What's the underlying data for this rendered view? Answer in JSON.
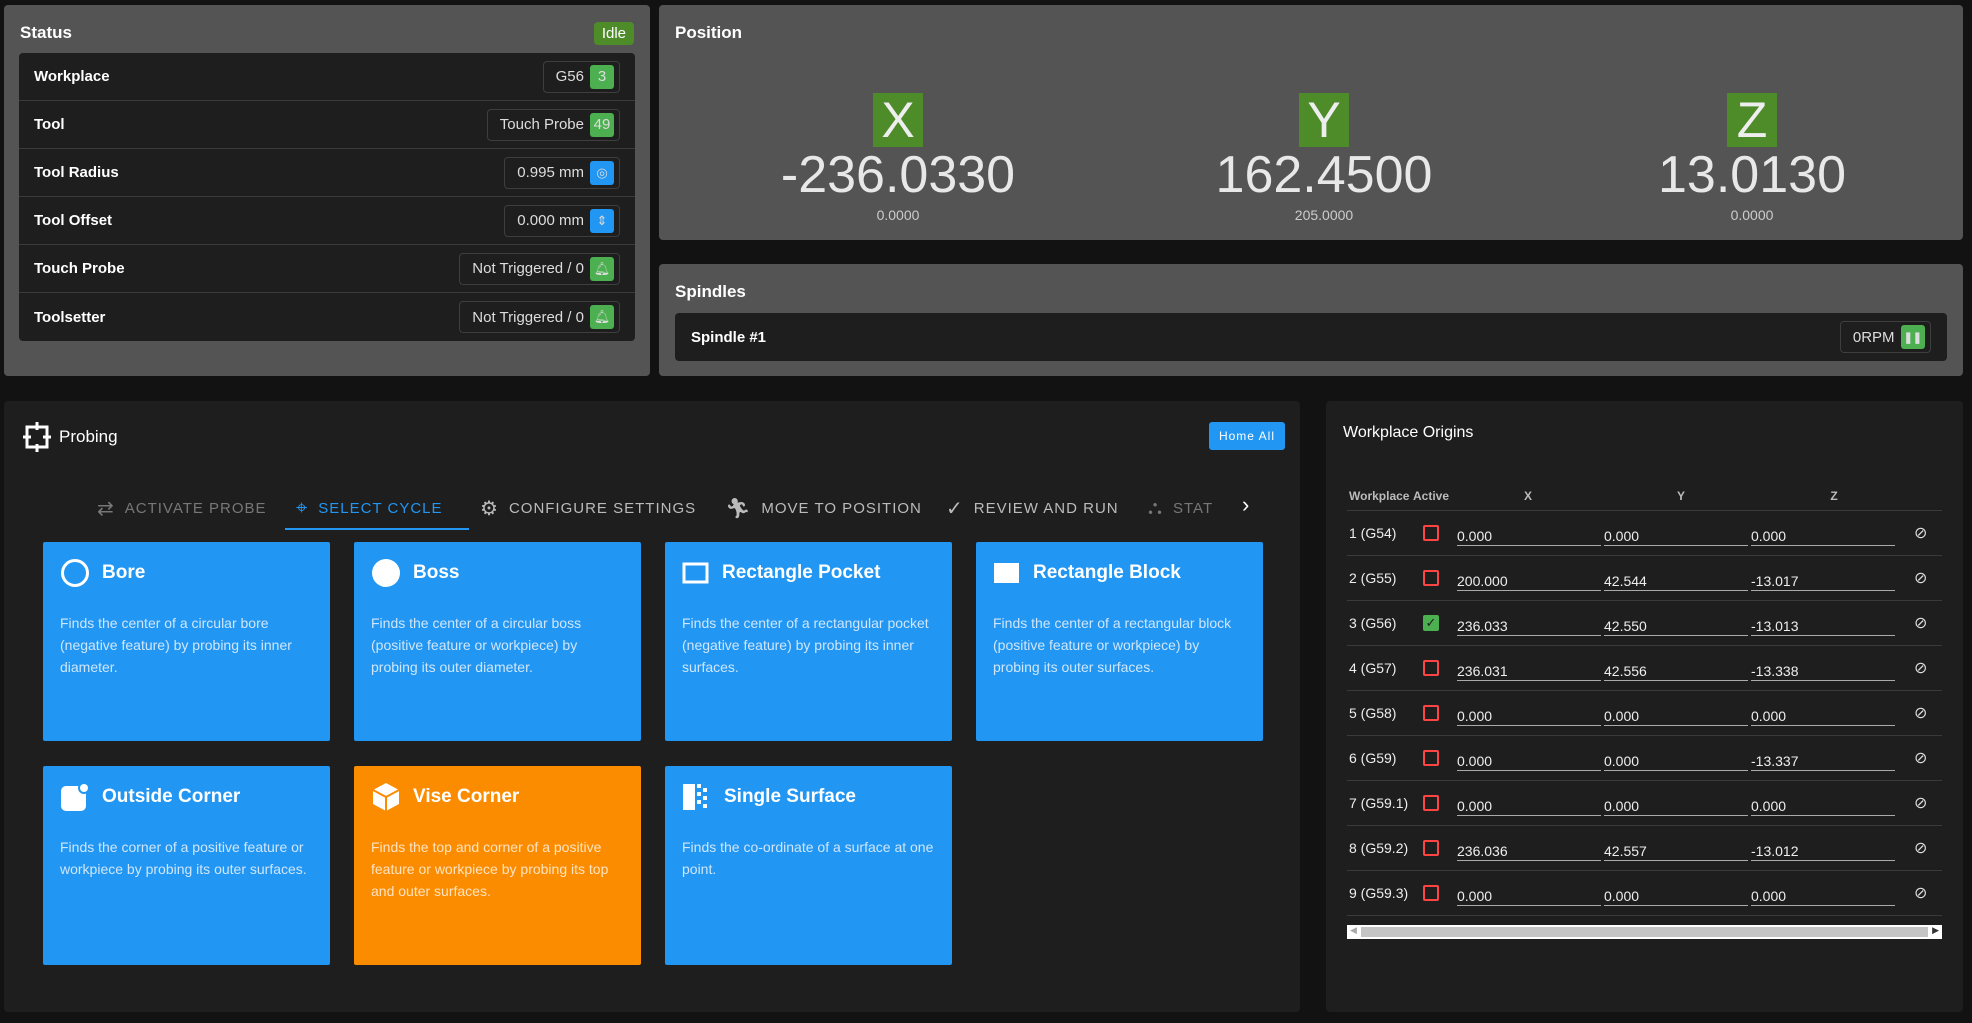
{
  "status": {
    "title": "Status",
    "state": "Idle",
    "rows": [
      {
        "label": "Workplace",
        "value": "G56",
        "chip": "3",
        "chip_color": "#4caf50",
        "icon": ""
      },
      {
        "label": "Tool",
        "value": "Touch Probe",
        "chip": "49",
        "chip_color": "#4caf50",
        "icon": ""
      },
      {
        "label": "Tool Radius",
        "value": "0.995 mm",
        "chip": "",
        "chip_color": "#2196f3",
        "icon": "radius-icon"
      },
      {
        "label": "Tool Offset",
        "value": "0.000 mm",
        "chip": "",
        "chip_color": "#2196f3",
        "icon": "height-offset-icon"
      },
      {
        "label": "Touch Probe",
        "value": "Not Triggered / 0",
        "chip": "",
        "chip_color": "#4caf50",
        "icon": "bell-z-icon"
      },
      {
        "label": "Toolsetter",
        "value": "Not Triggered / 0",
        "chip": "",
        "chip_color": "#4caf50",
        "icon": "bell-z-icon"
      }
    ]
  },
  "position": {
    "title": "Position",
    "axes": [
      {
        "label": "X",
        "value": "-236.0330",
        "sub": "0.0000"
      },
      {
        "label": "Y",
        "value": "162.4500",
        "sub": "205.0000"
      },
      {
        "label": "Z",
        "value": "13.0130",
        "sub": "0.0000"
      }
    ]
  },
  "spindles": {
    "title": "Spindles",
    "items": [
      {
        "name": "Spindle #1",
        "rpm": "0RPM",
        "icon": "pause-icon"
      }
    ]
  },
  "probing": {
    "title": "Probing",
    "home_all": "Home All",
    "tabs": [
      {
        "label": "ACTIVATE PROBE",
        "icon": "swap-icon",
        "state": "disabled"
      },
      {
        "label": "SELECT CYCLE",
        "icon": "crosshair-icon",
        "state": "active"
      },
      {
        "label": "CONFIGURE SETTINGS",
        "icon": "gear-icon",
        "state": "normal"
      },
      {
        "label": "MOVE TO POSITION",
        "icon": "running-icon",
        "state": "normal"
      },
      {
        "label": "REVIEW AND RUN",
        "icon": "check-icon",
        "state": "normal"
      },
      {
        "label": "STAT",
        "icon": "graph-icon",
        "state": "disabled"
      }
    ],
    "cycles": [
      {
        "title": "Bore",
        "desc": "Finds the center of a circular bore (negative feature) by probing its inner diameter.",
        "icon": "circle-outline-icon",
        "color": "#2196f3"
      },
      {
        "title": "Boss",
        "desc": "Finds the center of a circular boss (positive feature or workpiece) by probing its outer diameter.",
        "icon": "circle-filled-icon",
        "color": "#2196f3"
      },
      {
        "title": "Rectangle Pocket",
        "desc": "Finds the center of a rectangular pocket (negative feature) by probing its inner surfaces.",
        "icon": "square-outline-icon",
        "color": "#2196f3"
      },
      {
        "title": "Rectangle Block",
        "desc": "Finds the center of a rectangular block (positive feature or workpiece) by probing its outer surfaces.",
        "icon": "square-filled-icon",
        "color": "#2196f3"
      },
      {
        "title": "Outside Corner",
        "desc": "Finds the corner of a positive feature or workpiece by probing its outer surfaces.",
        "icon": "corner-icon",
        "color": "#2196f3"
      },
      {
        "title": "Vise Corner",
        "desc": "Finds the top and corner of a positive feature or workpiece by probing its top and outer surfaces.",
        "icon": "cube-icon",
        "color": "#fb8c00"
      },
      {
        "title": "Single Surface",
        "desc": "Finds the co-ordinate of a surface at one point.",
        "icon": "surface-icon",
        "color": "#2196f3"
      }
    ]
  },
  "origins": {
    "title": "Workplace Origins",
    "headers": [
      "Workplace",
      "Active",
      "X",
      "Y",
      "Z"
    ],
    "rows": [
      {
        "name": "1 (G54)",
        "active": false,
        "x": "0.000",
        "y": "0.000",
        "z": "0.000"
      },
      {
        "name": "2 (G55)",
        "active": false,
        "x": "200.000",
        "y": "42.544",
        "z": "-13.017"
      },
      {
        "name": "3 (G56)",
        "active": true,
        "x": "236.033",
        "y": "42.550",
        "z": "-13.013"
      },
      {
        "name": "4 (G57)",
        "active": false,
        "x": "236.031",
        "y": "42.556",
        "z": "-13.338"
      },
      {
        "name": "5 (G58)",
        "active": false,
        "x": "0.000",
        "y": "0.000",
        "z": "0.000"
      },
      {
        "name": "6 (G59)",
        "active": false,
        "x": "0.000",
        "y": "0.000",
        "z": "-13.337"
      },
      {
        "name": "7 (G59.1)",
        "active": false,
        "x": "0.000",
        "y": "0.000",
        "z": "0.000"
      },
      {
        "name": "8 (G59.2)",
        "active": false,
        "x": "236.036",
        "y": "42.557",
        "z": "-13.012"
      },
      {
        "name": "9 (G59.3)",
        "active": false,
        "x": "0.000",
        "y": "0.000",
        "z": "0.000"
      }
    ]
  }
}
